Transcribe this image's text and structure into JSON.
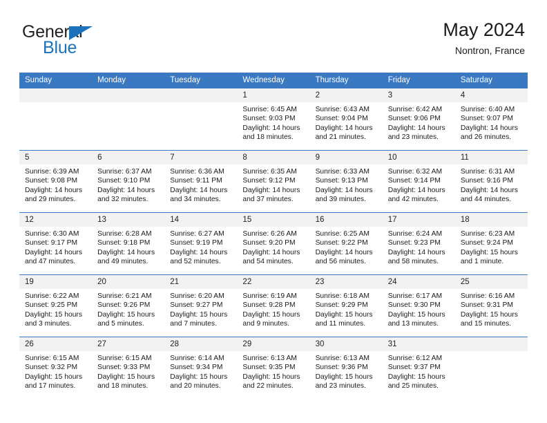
{
  "brand": {
    "word_one": "General",
    "word_two": "Blue",
    "logo_icon": "triangle-logo-icon"
  },
  "header": {
    "title": "May 2024",
    "subtitle": "Nontron, France"
  },
  "weekday_headers": [
    "Sunday",
    "Monday",
    "Tuesday",
    "Wednesday",
    "Thursday",
    "Friday",
    "Saturday"
  ],
  "colors": {
    "header_blue": "#3a78c2",
    "brand_blue": "#1c72bb",
    "daynum_band": "#f2f2f2",
    "text": "#1a1a1a"
  },
  "weeks": [
    [
      {
        "day": "",
        "empty": true
      },
      {
        "day": "",
        "empty": true
      },
      {
        "day": "",
        "empty": true
      },
      {
        "day": "1",
        "sunrise": "Sunrise: 6:45 AM",
        "sunset": "Sunset: 9:03 PM",
        "daylight_line1": "Daylight: 14 hours",
        "daylight_line2": "and 18 minutes."
      },
      {
        "day": "2",
        "sunrise": "Sunrise: 6:43 AM",
        "sunset": "Sunset: 9:04 PM",
        "daylight_line1": "Daylight: 14 hours",
        "daylight_line2": "and 21 minutes."
      },
      {
        "day": "3",
        "sunrise": "Sunrise: 6:42 AM",
        "sunset": "Sunset: 9:06 PM",
        "daylight_line1": "Daylight: 14 hours",
        "daylight_line2": "and 23 minutes."
      },
      {
        "day": "4",
        "sunrise": "Sunrise: 6:40 AM",
        "sunset": "Sunset: 9:07 PM",
        "daylight_line1": "Daylight: 14 hours",
        "daylight_line2": "and 26 minutes."
      }
    ],
    [
      {
        "day": "5",
        "sunrise": "Sunrise: 6:39 AM",
        "sunset": "Sunset: 9:08 PM",
        "daylight_line1": "Daylight: 14 hours",
        "daylight_line2": "and 29 minutes."
      },
      {
        "day": "6",
        "sunrise": "Sunrise: 6:37 AM",
        "sunset": "Sunset: 9:10 PM",
        "daylight_line1": "Daylight: 14 hours",
        "daylight_line2": "and 32 minutes."
      },
      {
        "day": "7",
        "sunrise": "Sunrise: 6:36 AM",
        "sunset": "Sunset: 9:11 PM",
        "daylight_line1": "Daylight: 14 hours",
        "daylight_line2": "and 34 minutes."
      },
      {
        "day": "8",
        "sunrise": "Sunrise: 6:35 AM",
        "sunset": "Sunset: 9:12 PM",
        "daylight_line1": "Daylight: 14 hours",
        "daylight_line2": "and 37 minutes."
      },
      {
        "day": "9",
        "sunrise": "Sunrise: 6:33 AM",
        "sunset": "Sunset: 9:13 PM",
        "daylight_line1": "Daylight: 14 hours",
        "daylight_line2": "and 39 minutes."
      },
      {
        "day": "10",
        "sunrise": "Sunrise: 6:32 AM",
        "sunset": "Sunset: 9:14 PM",
        "daylight_line1": "Daylight: 14 hours",
        "daylight_line2": "and 42 minutes."
      },
      {
        "day": "11",
        "sunrise": "Sunrise: 6:31 AM",
        "sunset": "Sunset: 9:16 PM",
        "daylight_line1": "Daylight: 14 hours",
        "daylight_line2": "and 44 minutes."
      }
    ],
    [
      {
        "day": "12",
        "sunrise": "Sunrise: 6:30 AM",
        "sunset": "Sunset: 9:17 PM",
        "daylight_line1": "Daylight: 14 hours",
        "daylight_line2": "and 47 minutes."
      },
      {
        "day": "13",
        "sunrise": "Sunrise: 6:28 AM",
        "sunset": "Sunset: 9:18 PM",
        "daylight_line1": "Daylight: 14 hours",
        "daylight_line2": "and 49 minutes."
      },
      {
        "day": "14",
        "sunrise": "Sunrise: 6:27 AM",
        "sunset": "Sunset: 9:19 PM",
        "daylight_line1": "Daylight: 14 hours",
        "daylight_line2": "and 52 minutes."
      },
      {
        "day": "15",
        "sunrise": "Sunrise: 6:26 AM",
        "sunset": "Sunset: 9:20 PM",
        "daylight_line1": "Daylight: 14 hours",
        "daylight_line2": "and 54 minutes."
      },
      {
        "day": "16",
        "sunrise": "Sunrise: 6:25 AM",
        "sunset": "Sunset: 9:22 PM",
        "daylight_line1": "Daylight: 14 hours",
        "daylight_line2": "and 56 minutes."
      },
      {
        "day": "17",
        "sunrise": "Sunrise: 6:24 AM",
        "sunset": "Sunset: 9:23 PM",
        "daylight_line1": "Daylight: 14 hours",
        "daylight_line2": "and 58 minutes."
      },
      {
        "day": "18",
        "sunrise": "Sunrise: 6:23 AM",
        "sunset": "Sunset: 9:24 PM",
        "daylight_line1": "Daylight: 15 hours",
        "daylight_line2": "and 1 minute."
      }
    ],
    [
      {
        "day": "19",
        "sunrise": "Sunrise: 6:22 AM",
        "sunset": "Sunset: 9:25 PM",
        "daylight_line1": "Daylight: 15 hours",
        "daylight_line2": "and 3 minutes."
      },
      {
        "day": "20",
        "sunrise": "Sunrise: 6:21 AM",
        "sunset": "Sunset: 9:26 PM",
        "daylight_line1": "Daylight: 15 hours",
        "daylight_line2": "and 5 minutes."
      },
      {
        "day": "21",
        "sunrise": "Sunrise: 6:20 AM",
        "sunset": "Sunset: 9:27 PM",
        "daylight_line1": "Daylight: 15 hours",
        "daylight_line2": "and 7 minutes."
      },
      {
        "day": "22",
        "sunrise": "Sunrise: 6:19 AM",
        "sunset": "Sunset: 9:28 PM",
        "daylight_line1": "Daylight: 15 hours",
        "daylight_line2": "and 9 minutes."
      },
      {
        "day": "23",
        "sunrise": "Sunrise: 6:18 AM",
        "sunset": "Sunset: 9:29 PM",
        "daylight_line1": "Daylight: 15 hours",
        "daylight_line2": "and 11 minutes."
      },
      {
        "day": "24",
        "sunrise": "Sunrise: 6:17 AM",
        "sunset": "Sunset: 9:30 PM",
        "daylight_line1": "Daylight: 15 hours",
        "daylight_line2": "and 13 minutes."
      },
      {
        "day": "25",
        "sunrise": "Sunrise: 6:16 AM",
        "sunset": "Sunset: 9:31 PM",
        "daylight_line1": "Daylight: 15 hours",
        "daylight_line2": "and 15 minutes."
      }
    ],
    [
      {
        "day": "26",
        "sunrise": "Sunrise: 6:15 AM",
        "sunset": "Sunset: 9:32 PM",
        "daylight_line1": "Daylight: 15 hours",
        "daylight_line2": "and 17 minutes."
      },
      {
        "day": "27",
        "sunrise": "Sunrise: 6:15 AM",
        "sunset": "Sunset: 9:33 PM",
        "daylight_line1": "Daylight: 15 hours",
        "daylight_line2": "and 18 minutes."
      },
      {
        "day": "28",
        "sunrise": "Sunrise: 6:14 AM",
        "sunset": "Sunset: 9:34 PM",
        "daylight_line1": "Daylight: 15 hours",
        "daylight_line2": "and 20 minutes."
      },
      {
        "day": "29",
        "sunrise": "Sunrise: 6:13 AM",
        "sunset": "Sunset: 9:35 PM",
        "daylight_line1": "Daylight: 15 hours",
        "daylight_line2": "and 22 minutes."
      },
      {
        "day": "30",
        "sunrise": "Sunrise: 6:13 AM",
        "sunset": "Sunset: 9:36 PM",
        "daylight_line1": "Daylight: 15 hours",
        "daylight_line2": "and 23 minutes."
      },
      {
        "day": "31",
        "sunrise": "Sunrise: 6:12 AM",
        "sunset": "Sunset: 9:37 PM",
        "daylight_line1": "Daylight: 15 hours",
        "daylight_line2": "and 25 minutes."
      },
      {
        "day": "",
        "empty": true
      }
    ]
  ]
}
